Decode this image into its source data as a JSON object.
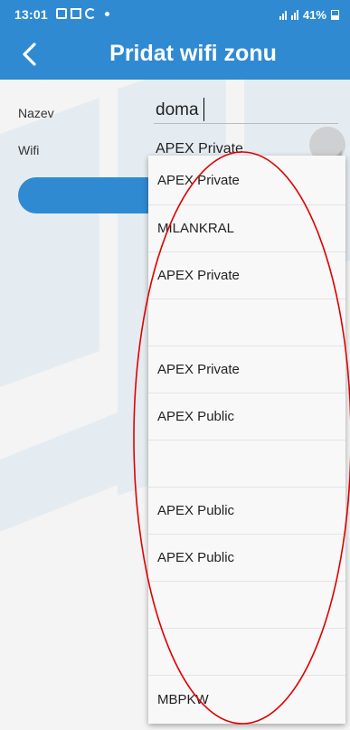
{
  "status_bar": {
    "time": "13:01",
    "notification_icons": [
      "gallery-icon",
      "gmail-icon",
      "google-icon"
    ],
    "battery": "41%"
  },
  "app_bar": {
    "title": "Pridat wifi zonu",
    "back_icon": "chevron-left-icon"
  },
  "form": {
    "name_label": "Nazev",
    "name_value": "doma",
    "wifi_label": "Wifi",
    "wifi_selected": "APEX Private"
  },
  "dropdown": {
    "options": [
      "APEX Private",
      "MILANKRAL",
      "APEX Private",
      "",
      "APEX Private",
      "APEX Public",
      "",
      "APEX Public",
      "APEX Public",
      "",
      "",
      "MBPKW"
    ]
  },
  "colors": {
    "accent": "#2f8ad2",
    "annotation": "#e00000"
  }
}
